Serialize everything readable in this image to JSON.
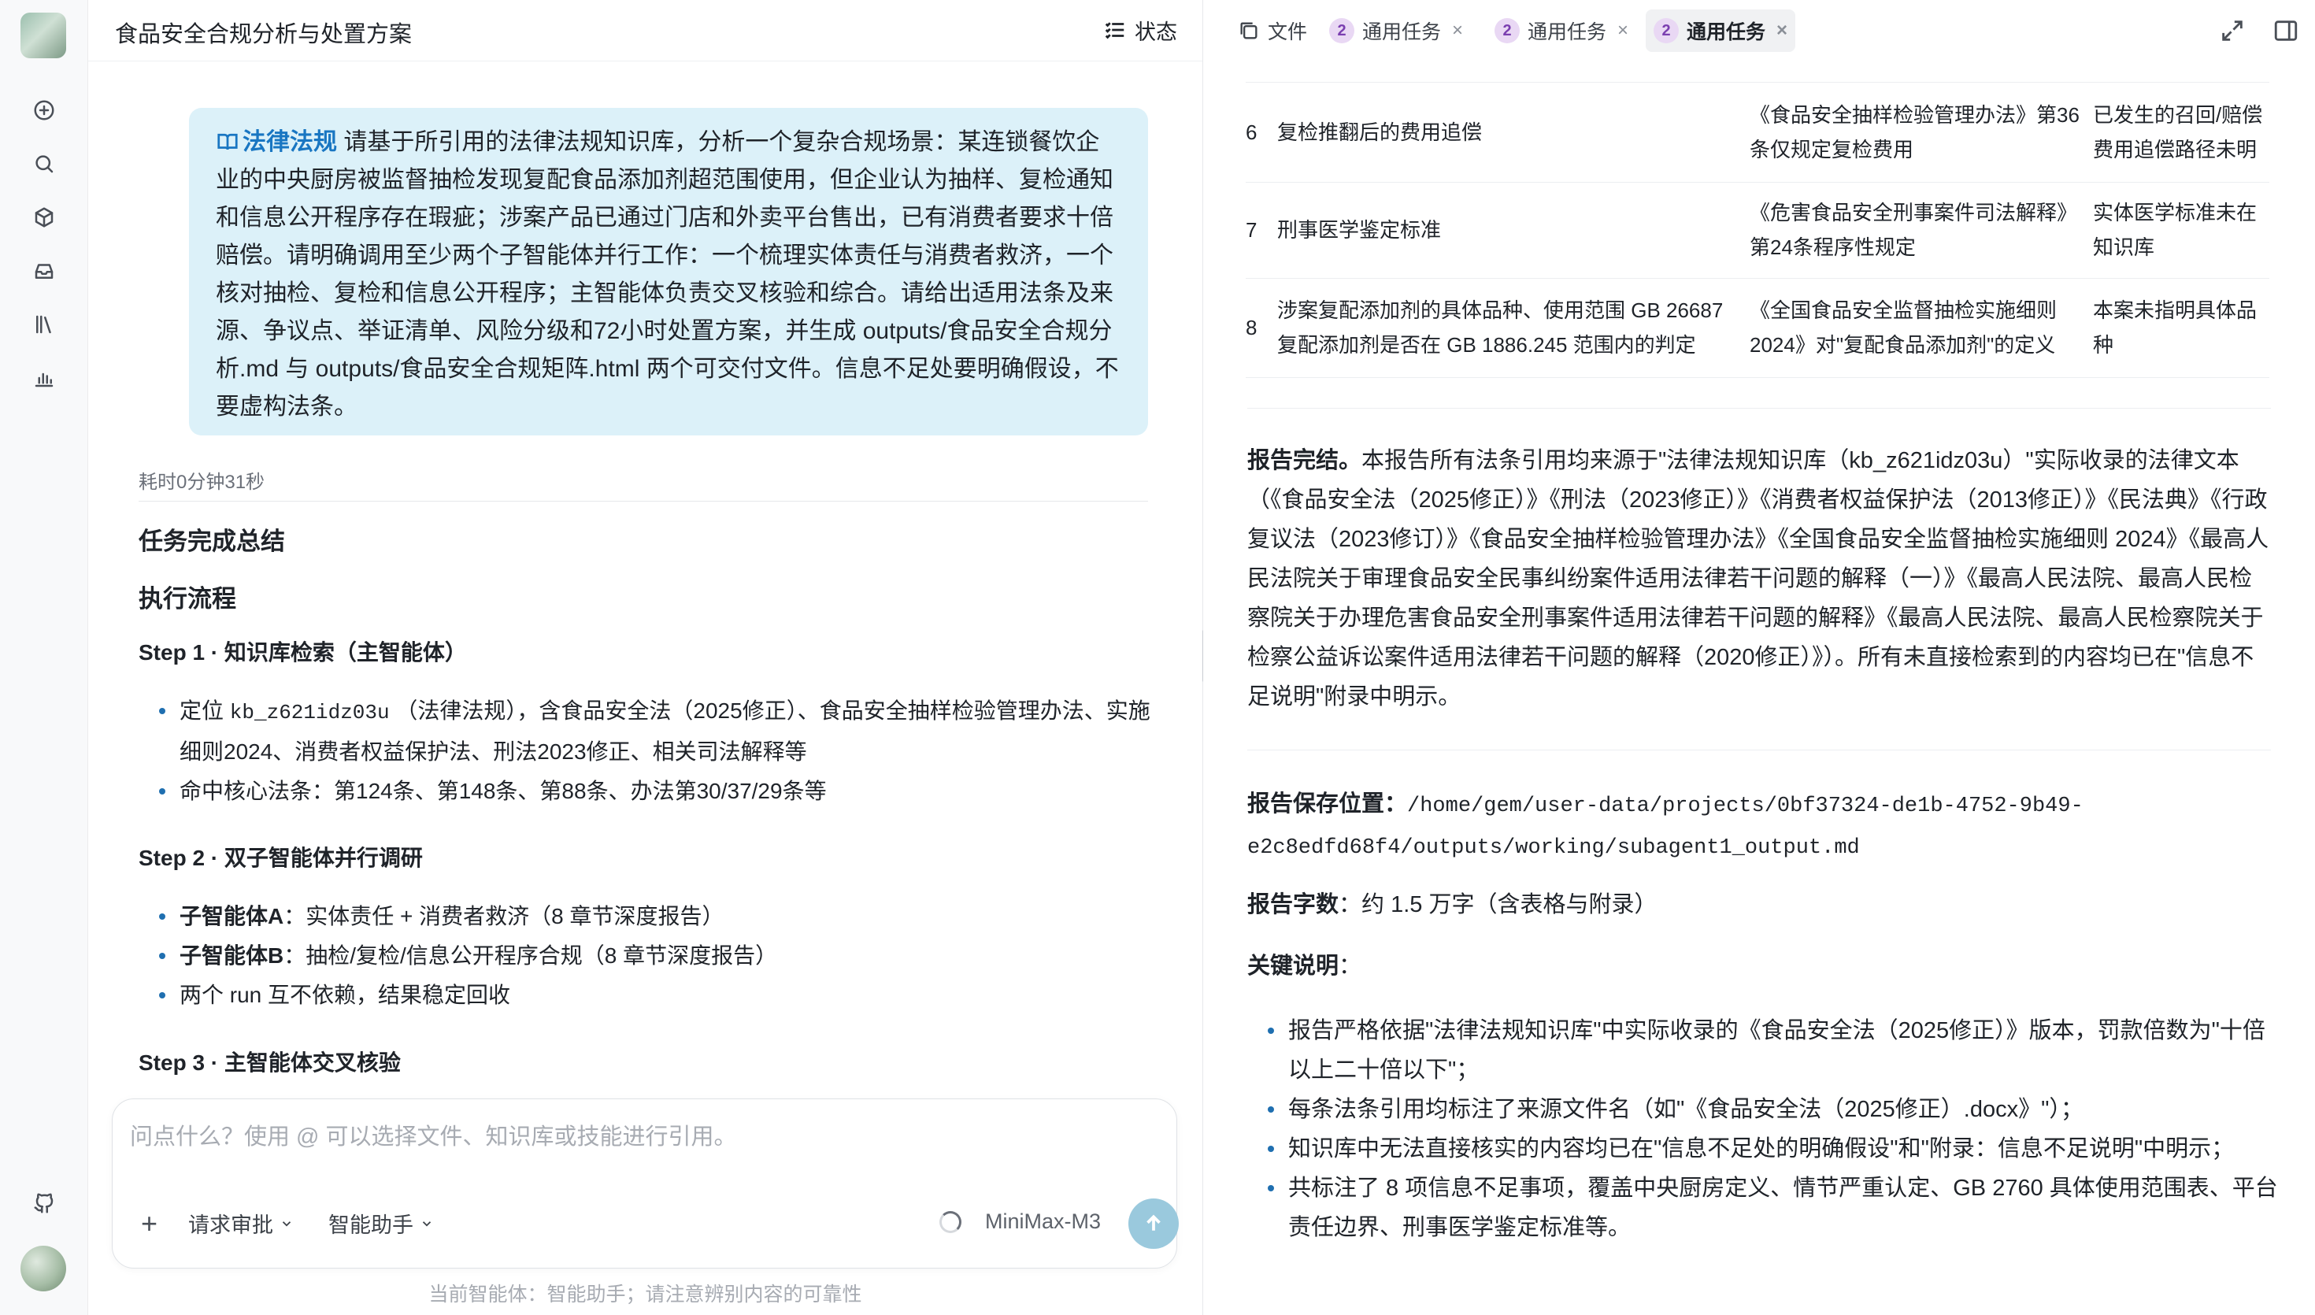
{
  "conversation": {
    "title": "食品安全合规分析与处置方案",
    "status_label": "状态"
  },
  "user_message": {
    "tag": "法律法规",
    "text": "请基于所引用的法律法规知识库，分析一个复杂合规场景：某连锁餐饮企业的中央厨房被监督抽检发现复配食品添加剂超范围使用，但企业认为抽样、复检通知和信息公开程序存在瑕疵；涉案产品已通过门店和外卖平台售出，已有消费者要求十倍赔偿。请明确调用至少两个子智能体并行工作：一个梳理实体责任与消费者救济，一个核对抽检、复检和信息公开程序；主智能体负责交叉核验和综合。请给出适用法条及来源、争议点、举证清单、风险分级和72小时处置方案，并生成 outputs/食品安全合规分析.md 与 outputs/食品安全合规矩阵.html 两个可交付文件。信息不足处要明确假设，不要虚构法条。"
  },
  "response": {
    "elapsed": "耗时0分钟31秒",
    "summary_title": "任务完成总结",
    "flow_title": "执行流程",
    "step1_title": "Step 1 · 知识库检索（主智能体）",
    "step1_b1_pre": "定位 ",
    "step1_b1_code": "kb_z621idz03u",
    "step1_b1_post": " （法律法规），含食品安全法（2025修正）、食品安全抽样检验管理办法、实施细则2024、消费者权益保护法、刑法2023修正、相关司法解释等",
    "step1_b2": "命中核心法条：第124条、第148条、第88条、办法第30/37/29条等",
    "step2_title": "Step 2 · 双子智能体并行调研",
    "step2_b1_bold": "子智能体A",
    "step2_b1_rest": "：实体责任 + 消费者救济（8 章节深度报告）",
    "step2_b2_bold": "子智能体B",
    "step2_b2_rest": "：抽检/复检/信息公开程序合规（8 章节深度报告）",
    "step2_b3": "两个 run 互不依赖，结果稳定回收",
    "step3_title": "Step 3 · 主智能体交叉核验"
  },
  "composer": {
    "placeholder": "问点什么？使用 @ 可以选择文件、知识库或技能进行引用。",
    "plus_label": "+",
    "approval_label": "请求审批",
    "agent_label": "智能助手",
    "model_label": "MiniMax-M3",
    "footnote": "当前智能体：智能助手；请注意辨别内容的可靠性"
  },
  "tabs": [
    {
      "label": "文件"
    },
    {
      "label": "通用任务",
      "badge": "2",
      "close": "×"
    },
    {
      "label": "通用任务",
      "badge": "2",
      "close": "×"
    },
    {
      "label": "通用任务",
      "badge": "2",
      "close": "×"
    }
  ],
  "table_rows": [
    {
      "num": "6",
      "issue": "复检推翻后的费用追偿",
      "basis": "《食品安全抽样检验管理办法》第36条仅规定复检费用",
      "gap": "已发生的召回/赔偿费用追偿路径未明"
    },
    {
      "num": "7",
      "issue": "刑事医学鉴定标准",
      "basis": "《危害食品安全刑事案件司法解释》第24条程序性规定",
      "gap": "实体医学标准未在知识库"
    },
    {
      "num": "8",
      "issue": "涉案复配添加剂的具体品种、使用范围 GB 26687复配添加剂是否在 GB 1886.245 范围内的判定",
      "basis": "《全国食品安全监督抽检实施细则2024》对\"复配食品添加剂\"的定义",
      "gap": "本案未指明具体品种"
    }
  ],
  "report": {
    "done_bold": "报告完结。",
    "done_text": "本报告所有法条引用均来源于\"法律法规知识库（kb_z621idz03u）\"实际收录的法律文本（《食品安全法（2025修正）》《刑法（2023修正）》《消费者权益保护法（2013修正）》《民法典》《行政复议法（2023修订）》《食品安全抽样检验管理办法》《全国食品安全监督抽检实施细则 2024》《最高人民法院关于审理食品安全民事纠纷案件适用法律若干问题的解释（一）》《最高人民法院、最高人民检察院关于办理危害食品安全刑事案件适用法律若干问题的解释》《最高人民法院、最高人民检察院关于检察公益诉讼案件适用法律若干问题的解释（2020修正）》）。所有未直接检索到的内容均已在\"信息不足说明\"附录中明示。",
    "path_label": "报告保存位置",
    "path_value": "/home/gem/user-data/projects/0bf37324-de1b-4752-9b49-e2c8edfd68f4/outputs/working/subagent1_output.md",
    "count_label": "报告字数",
    "count_value": "：约 1.5 万字（含表格与附录）",
    "notes_label": "关键说明",
    "notes": [
      "报告严格依据\"法律法规知识库\"中实际收录的《食品安全法（2025修正）》版本，罚款倍数为\"十倍以上二十倍以下\"；",
      "每条法条引用均标注了来源文件名（如\"《食品安全法（2025修正）.docx》\"）；",
      "知识库中无法直接核实的内容均已在\"信息不足处的明确假设\"和\"附录：信息不足说明\"中明示；",
      "共标注了 8 项信息不足事项，覆盖中央厨房定义、情节严重认定、GB 2760 具体使用范围表、平台责任边界、刑事医学鉴定标准等。"
    ]
  },
  "colors": {
    "accent": "#1976c2",
    "bubble": "#dcf1f9",
    "send": "#9ac9dd",
    "badge": "#e9d8f4"
  },
  "icons": [
    "new-chat-icon",
    "search-icon",
    "cube-icon",
    "inbox-icon",
    "library-icon",
    "chart-icon",
    "github-icon",
    "list-icon",
    "book-icon",
    "file-icon",
    "expand-icon",
    "panel-icon",
    "arrow-up-icon",
    "chevron-down-icon"
  ]
}
